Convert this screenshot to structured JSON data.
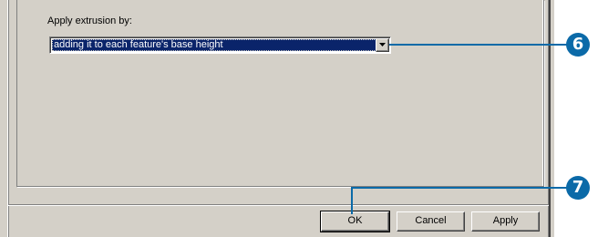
{
  "form": {
    "extrusion_label": "Apply extrusion by:",
    "extrusion_value": "adding it to each feature's base height"
  },
  "buttons": {
    "ok": "OK",
    "cancel": "Cancel",
    "apply": "Apply"
  },
  "callouts": {
    "dropdown_step": "6",
    "ok_step": "7"
  },
  "icons": {
    "dropdown_arrow": "chevron-down-icon"
  },
  "colors": {
    "dialog_face": "#d4d0c8",
    "selection_highlight": "#0a246a",
    "callout_blue": "#0b6aa8"
  }
}
